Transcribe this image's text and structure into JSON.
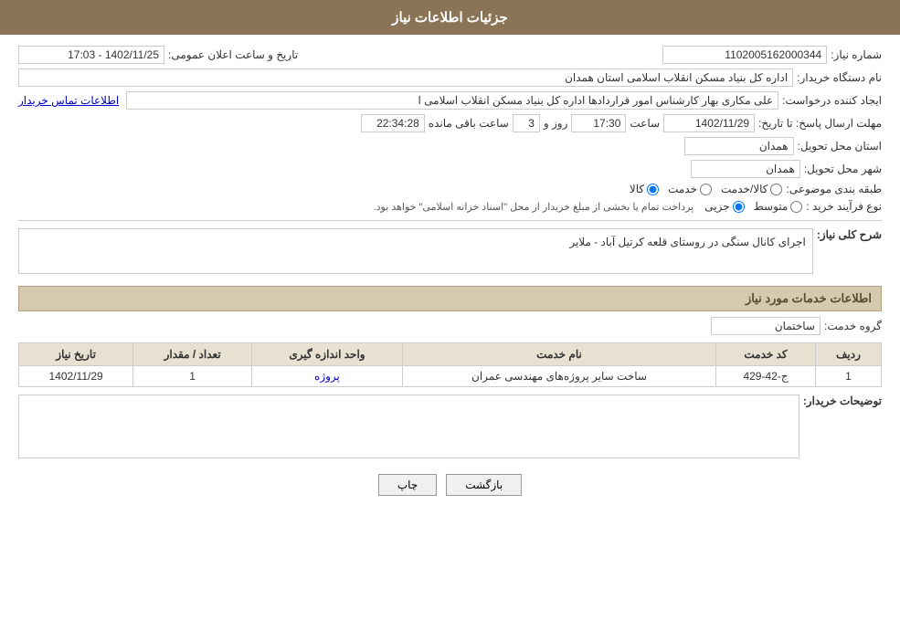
{
  "header": {
    "title": "جزئیات اطلاعات نیاز"
  },
  "fields": {
    "tender_number_label": "شماره نیاز:",
    "tender_number_value": "1102005162000344",
    "announce_datetime_label": "تاریخ و ساعت اعلان عمومی:",
    "announce_datetime_value": "1402/11/25 - 17:03",
    "buyer_org_label": "نام دستگاه خریدار:",
    "buyer_org_value": "اداره کل بنیاد مسکن انقلاب اسلامی استان همدان",
    "creator_label": "ایجاد کننده درخواست:",
    "creator_value": "علی مکاری بهار کارشناس امور قراردادها اداره کل بنیاد مسکن انقلاب اسلامی ا",
    "creator_link": "اطلاعات تماس خریدار",
    "deadline_label": "مهلت ارسال پاسخ: تا تاریخ:",
    "deadline_date": "1402/11/29",
    "deadline_time_label": "ساعت",
    "deadline_time_value": "17:30",
    "deadline_days_label": "روز و",
    "deadline_days_value": "3",
    "deadline_remaining_label": "ساعت باقی مانده",
    "deadline_remaining_value": "22:34:28",
    "province_label": "استان محل تحویل:",
    "province_value": "همدان",
    "city_label": "شهر محل تحویل:",
    "city_value": "همدان",
    "category_label": "طبقه بندی موضوعی:",
    "category_options": [
      "کالا",
      "خدمت",
      "کالا/خدمت"
    ],
    "category_selected": "کالا",
    "purchase_type_label": "نوع فرآیند خرید :",
    "purchase_type_options": [
      "جزیی",
      "متوسط"
    ],
    "purchase_type_note": "پرداخت تمام یا بخشی از مبلغ خریدار از محل \"اسناد خزانه اسلامی\" خواهد بود.",
    "description_section": "شرح کلی نیاز:",
    "description_value": "اجرای کانال سنگی در روستای قلعه کرتیل آباد - ملایر",
    "services_section_title": "اطلاعات خدمات مورد نیاز",
    "service_group_label": "گروه خدمت:",
    "service_group_value": "ساختمان",
    "table": {
      "headers": [
        "ردیف",
        "کد خدمت",
        "نام خدمت",
        "واحد اندازه گیری",
        "تعداد / مقدار",
        "تاریخ نیاز"
      ],
      "rows": [
        {
          "row": "1",
          "code": "ج-42-429",
          "name": "ساخت سایر پروژه‌های مهندسی عمران",
          "unit": "پروژه",
          "qty": "1",
          "date": "1402/11/29"
        }
      ]
    },
    "buyer_notes_label": "توضیحات خریدار:",
    "buyer_notes_value": ""
  },
  "buttons": {
    "back": "بازگشت",
    "print": "چاپ"
  }
}
